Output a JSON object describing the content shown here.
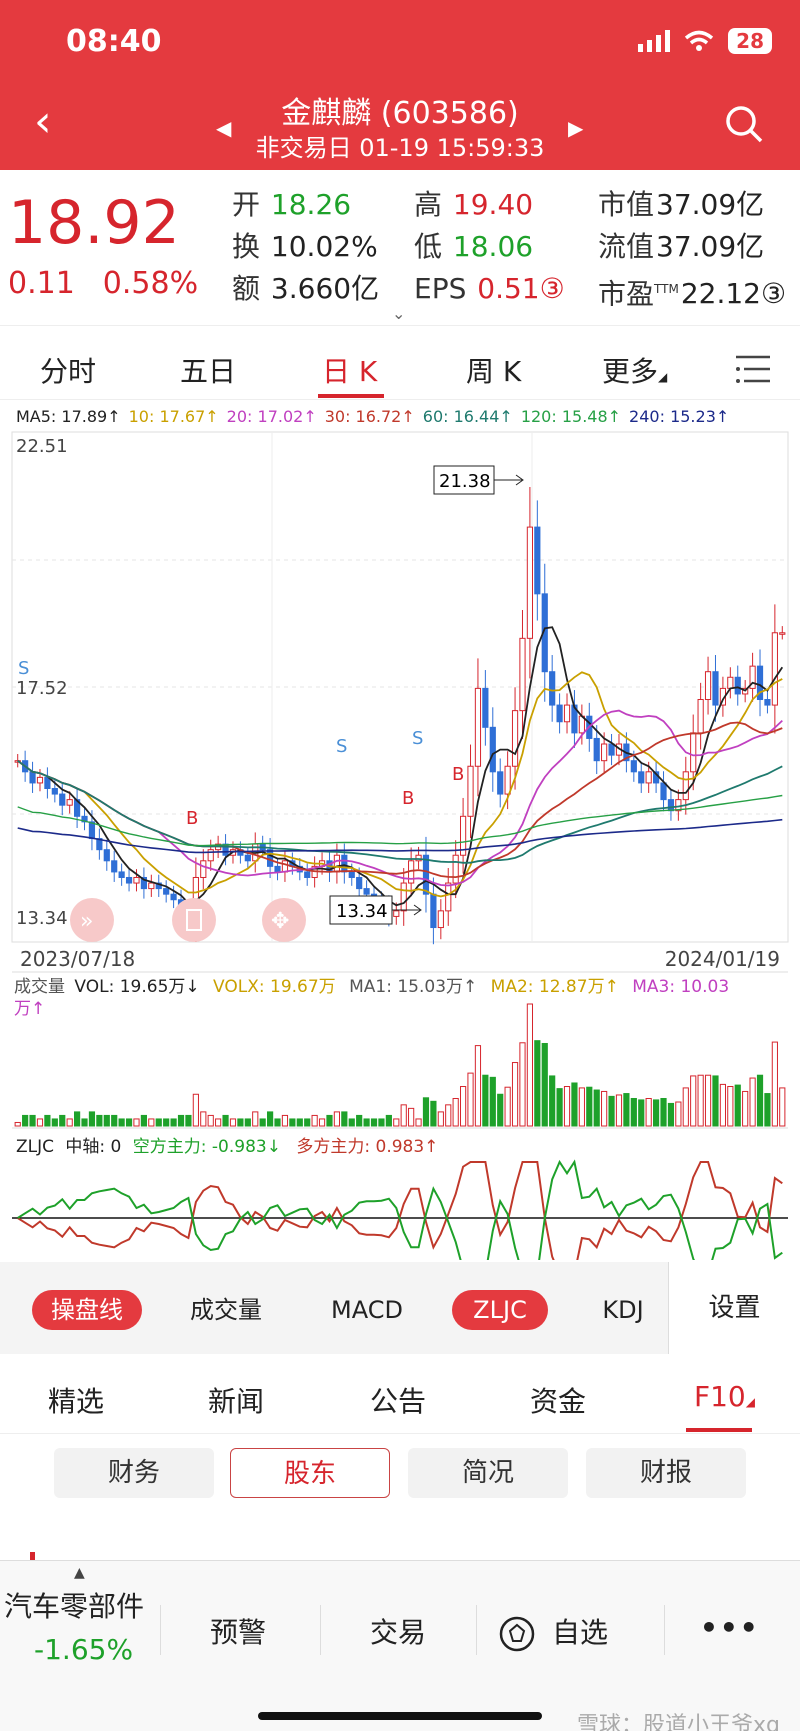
{
  "status": {
    "time": "08:40",
    "battery": "28"
  },
  "header": {
    "title": "金麒麟 (603586)",
    "subtitle": "非交易日 01-19 15:59:33"
  },
  "quote": {
    "price": "18.92",
    "change": "0.11",
    "change_pct": "0.58%",
    "open_label": "开",
    "open": "18.26",
    "turnover_label": "换",
    "turnover": "10.02%",
    "amount_label": "额",
    "amount": "3.660亿",
    "high_label": "高",
    "high": "19.40",
    "low_label": "低",
    "low": "18.06",
    "eps_label": "EPS",
    "eps": "0.51③",
    "mcap_label": "市值",
    "mcap": "37.09亿",
    "float_label": "流值",
    "float": "37.09亿",
    "pe_label": "市盈",
    "pe_sup": "TTM",
    "pe": "22.12③"
  },
  "tabs": [
    "分时",
    "五日",
    "日 K",
    "周 K",
    "更多"
  ],
  "ma_line": [
    {
      "text": "MA5: 17.89↑",
      "color": "#222222"
    },
    {
      "text": "10: 17.67↑",
      "color": "#c9a000"
    },
    {
      "text": "20: 17.02↑",
      "color": "#c040c0"
    },
    {
      "text": "30: 16.72↑",
      "color": "#c0392b"
    },
    {
      "text": "60: 16.44↑",
      "color": "#1f7a6e"
    },
    {
      "text": "120: 15.48↑",
      "color": "#27a046"
    },
    {
      "text": "240: 15.23↑",
      "color": "#1c2a8a"
    }
  ],
  "chart_data": {
    "type": "candlestick",
    "ylim": [
      13.34,
      22.51
    ],
    "y_labels": [
      "22.51",
      "17.52",
      "13.34"
    ],
    "x_start": "2023/07/18",
    "x_end": "2024/01/19",
    "annotations": {
      "max": "21.38",
      "min": "13.34",
      "signals": [
        "S",
        "S",
        "S",
        "B",
        "B",
        "B"
      ]
    },
    "closes": [
      16.6,
      16.4,
      16.2,
      16.3,
      16.1,
      16.0,
      15.8,
      15.9,
      15.6,
      15.5,
      15.2,
      15.0,
      14.8,
      14.6,
      14.5,
      14.4,
      14.5,
      14.3,
      14.4,
      14.3,
      14.2,
      14.1,
      13.9,
      13.7,
      14.5,
      14.8,
      15.0,
      15.1,
      14.9,
      15.0,
      14.9,
      14.8,
      15.1,
      15.0,
      14.7,
      14.6,
      14.8,
      14.7,
      14.6,
      14.5,
      14.7,
      14.8,
      14.6,
      14.9,
      14.6,
      14.5,
      14.3,
      14.2,
      14.1,
      14.0,
      13.8,
      13.9,
      14.4,
      14.8,
      14.9,
      14.2,
      13.6,
      13.9,
      14.4,
      14.9,
      15.6,
      16.5,
      17.9,
      17.2,
      16.4,
      16.0,
      16.5,
      17.5,
      18.8,
      20.8,
      19.6,
      18.2,
      17.6,
      17.3,
      17.6,
      17.1,
      17.4,
      17.0,
      16.6,
      16.9,
      16.7,
      16.9,
      16.6,
      16.4,
      16.2,
      16.4,
      16.2,
      15.9,
      15.7,
      15.9,
      16.4,
      17.1,
      17.7,
      18.2,
      17.6,
      17.9,
      18.1,
      17.8,
      17.9,
      18.3,
      17.7,
      17.6,
      18.9,
      18.9
    ]
  },
  "volume": {
    "label": "成交量",
    "vol": "VOL: 19.65万↓",
    "volx": "VOLX: 19.67万",
    "ma1": "MA1: 15.03万↑",
    "ma2": "MA2: 12.87万↑",
    "ma3": "MA3: 10.03",
    "ma3_wrap": "万↑"
  },
  "zljc": {
    "name": "ZLJC",
    "axis": "中轴: 0",
    "short": "空方主力: -0.983↓",
    "long": "多方主力: 0.983↑"
  },
  "indicator_tabs": [
    "操盘线",
    "成交量",
    "MACD",
    "ZLJC",
    "KDJ"
  ],
  "settings_label": "设置",
  "info_tabs": [
    "精选",
    "新闻",
    "公告",
    "资金",
    "F10"
  ],
  "sub_tabs": [
    "财务",
    "股东",
    "简况",
    "财报"
  ],
  "bottom": {
    "sector": "汽车零部件",
    "sector_change": "-1.65%",
    "alert": "预警",
    "trade": "交易",
    "watch": "自选",
    "watermark": "雪球：股道小王爷xq"
  },
  "colors": {
    "brand": "#e43a3f",
    "up": "#d6252d",
    "down": "#1ea12a"
  }
}
